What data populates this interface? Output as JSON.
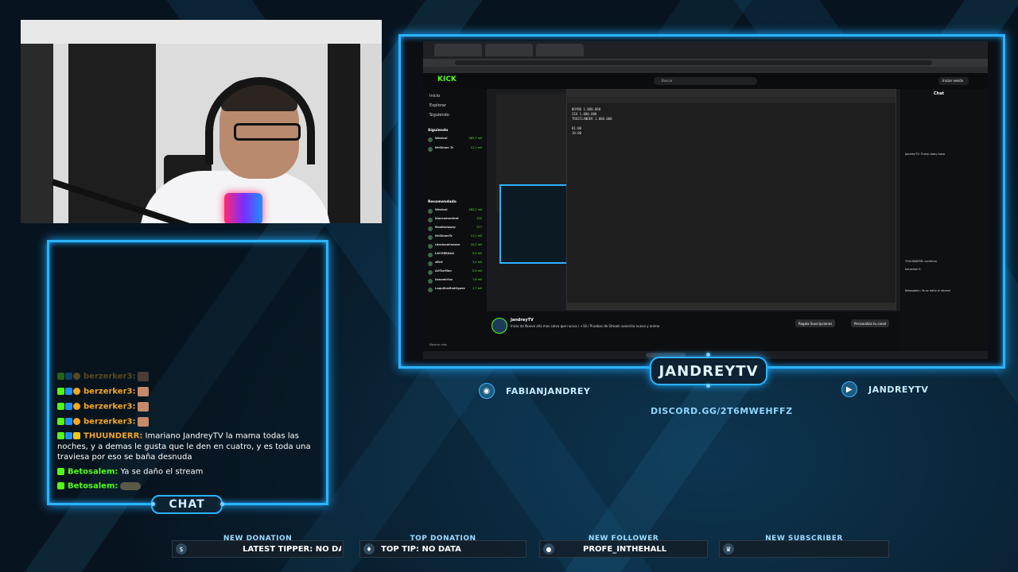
{
  "overlay": {
    "streamer_name": "JANDREYTV",
    "chat_label": "CHAT",
    "socials": [
      {
        "icon": "camera-icon",
        "handle": "FABIANJANDREY"
      },
      {
        "icon": "youtube-icon",
        "handle": "JANDREYTV"
      }
    ],
    "discord": "DISCORD.GG/2T6MWEHFFZ",
    "stats": [
      {
        "title": "NEW DONATION",
        "value": "LATEST TIPPER: NO DA",
        "icon": "donation-icon"
      },
      {
        "title": "TOP DONATION",
        "value": "TOP TIP: NO DATA",
        "icon": "money-bag-icon"
      },
      {
        "title": "NEW FOLLOWER",
        "value": "PROFE_INTHEHALL",
        "icon": "person-icon"
      },
      {
        "title": "NEW SUBSCRIBER",
        "value": "",
        "icon": "crown-icon"
      }
    ],
    "accent": "#2bb3ff",
    "kick_green": "#53fc18"
  },
  "chat": {
    "messages": [
      {
        "user": "berzerker3:",
        "text": "",
        "faded": true
      },
      {
        "user": "berzerker3:",
        "text": ""
      },
      {
        "user": "berzerker3:",
        "text": ""
      },
      {
        "user": "berzerker3:",
        "text": ""
      },
      {
        "user": "THUUNDERR:",
        "text": "Imariano JandreyTV la mama todas las noches, y a demas le gusta que le den en cuatro, y es toda una traviesa por eso se baña desnuda"
      },
      {
        "user": "Betosalem:",
        "text": "Ya se daño el stream"
      },
      {
        "user": "Betosalem:",
        "text": ""
      }
    ]
  },
  "screen": {
    "kick_logo": "KICK",
    "search_placeholder": "Buscar",
    "login": "Iniciar sesión",
    "nav": [
      "Inicio",
      "Explorar",
      "Siguiendo"
    ],
    "following_title": "Siguiendo",
    "recommended_title": "Recomendado",
    "following": [
      {
        "name": "Westcol",
        "viewers": "483,7 mil"
      },
      {
        "name": "MrStiven Tc",
        "viewers": "21,1 mil"
      }
    ],
    "recommended": [
      {
        "name": "Westcol",
        "viewers": "482,2 mil"
      },
      {
        "name": "blancomonteat",
        "viewers": "102"
      },
      {
        "name": "Mashtoloway",
        "viewers": "577"
      },
      {
        "name": "MrStivenTc",
        "viewers": "21,1 mil"
      },
      {
        "name": "rdosluaminaseo",
        "viewers": "10,2 mil"
      },
      {
        "name": "LACOBRAAA",
        "viewers": "9,4 mil"
      },
      {
        "name": "zEkO",
        "viewers": "3,4 mil"
      },
      {
        "name": "AriTonMan",
        "viewers": "5,5 mil"
      },
      {
        "name": "llanemiriox",
        "viewers": "7,8 mil"
      },
      {
        "name": "LuquillasRodriguez",
        "viewers": "1,7 mil"
      }
    ],
    "show_more": "Mostrar más",
    "notepad_text": "BOYBD 1.000.000\nCEO 1.000.000\nTRUSTLANDER 1.000.000\n\n01:00\n10:00",
    "stream_name": "JandreyTV",
    "stream_title": "Inicio de Nuevo año mas calvo que nunca / +18 / Pruebas de Stream aviorcito nuevo y anime",
    "btn_subs": "Regala Suscripciones",
    "btn_custom": "Personaliza tu canal",
    "chat_title": "Chat",
    "chat_lines": [
      "Betosalem: Ya se daño el stream",
      "THUUNDERR: confirmo",
      "berzerker3:",
      "JandreyTV: Trump baby bosa"
    ]
  }
}
